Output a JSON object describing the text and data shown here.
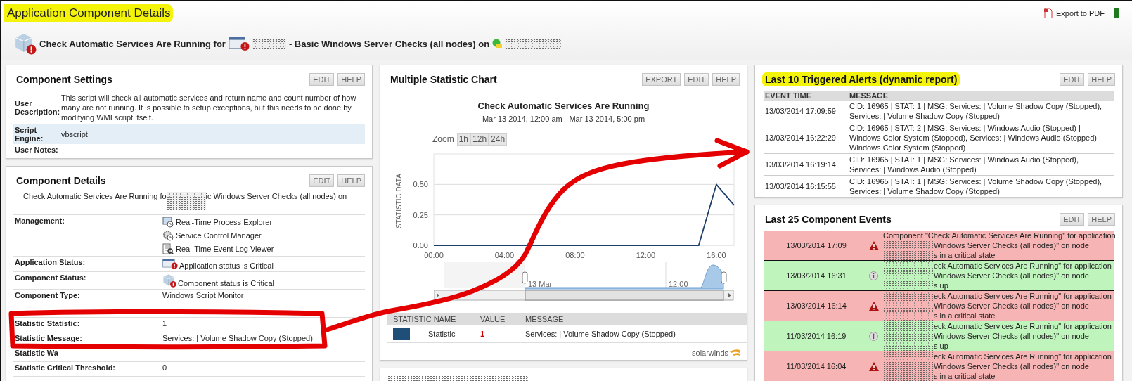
{
  "page": {
    "title": "Application Component Details",
    "export": "Export to PDF"
  },
  "heading": {
    "before": "Check Automatic Services Are Running for",
    "after": "- Basic Windows Server Checks (all nodes) on"
  },
  "component_settings": {
    "title": "Component Settings",
    "buttons": [
      "EDIT",
      "HELP"
    ],
    "rows": [
      {
        "label": "User Description:",
        "value": "This script will check all automatic services and return name and count number of how many are not running. It is possible to setup exceptions, but this needs to be done by modifying WMI script itself.",
        "shaded": false
      },
      {
        "label": "Script Engine:",
        "value": "vbscript",
        "shaded": true
      },
      {
        "label": "User Notes:",
        "shaded": false
      }
    ]
  },
  "component_details": {
    "title": "Component Details",
    "buttons": [
      "EDIT",
      "HELP"
    ],
    "summary": {
      "before": "Check Automatic Services Are Running fo",
      "after": "ic Windows Server Checks (all nodes) on"
    },
    "rows": [
      {
        "kind": "links",
        "label": "Management:",
        "items": [
          {
            "kind": "process",
            "text": "Real-Time Process Explorer"
          },
          {
            "kind": "service",
            "text": "Service Control Manager"
          },
          {
            "kind": "eventlog",
            "text": "Real-Time Event Log Viewer"
          }
        ]
      },
      {
        "kind": "app-status",
        "label": "Application Status:",
        "value": "Application status is Critical"
      },
      {
        "kind": "component-status",
        "label": "Component Status:",
        "value": "Component status is Critical"
      },
      {
        "kind": "text",
        "label": "Component Type:",
        "value": "Windows Script Monitor"
      },
      {
        "kind": "blank"
      },
      {
        "kind": "text",
        "label": "Statistic Statistic:",
        "value": "1"
      },
      {
        "kind": "text",
        "label": "Statistic Message:",
        "value": "Services: | Volume Shadow Copy (Stopped)"
      },
      {
        "kind": "text",
        "label": "Statistic Wa"
      },
      {
        "kind": "text",
        "label": "Statistic Critical Threshold:",
        "value": "0"
      }
    ]
  },
  "chart_panel": {
    "title": "Multiple Statistic Chart",
    "buttons": [
      "EXPORT",
      "EDIT",
      "HELP"
    ],
    "chart_title": "Check Automatic Services Are Running",
    "subtitle": "Mar 13 2014, 12:00 am - Mar 13 2014, 5:00 pm",
    "zoom": {
      "label": "Zoom",
      "options": [
        "1h",
        "12h",
        "24h"
      ]
    },
    "chart_data": {
      "type": "line",
      "ylabel": "STATISTIC DATA",
      "x": [
        0,
        1,
        2,
        3,
        4,
        5,
        6,
        7,
        8,
        9,
        10,
        11,
        12,
        13,
        14,
        15,
        16,
        17
      ],
      "series": [
        {
          "color": "#1f3f6b",
          "values": [
            0,
            0,
            0,
            0,
            0,
            0,
            0,
            0,
            0,
            0,
            0,
            0,
            0,
            0,
            0,
            0,
            0.5,
            0.33
          ]
        }
      ],
      "xlim": [
        0,
        17
      ],
      "ylim": [
        0,
        0.75
      ],
      "xticks": [
        {
          "value": 0,
          "label": "00:00"
        },
        {
          "value": 4,
          "label": "04:00"
        },
        {
          "value": 8,
          "label": "08:00"
        },
        {
          "value": 12,
          "label": "12:00"
        },
        {
          "value": 16,
          "label": "16:00"
        }
      ],
      "yticks": [
        {
          "value": 0,
          "label": "0.00"
        },
        {
          "value": 0.25,
          "label": "0.25"
        },
        {
          "value": 0.5,
          "label": "0.50"
        }
      ]
    },
    "navigator": {
      "labels": [
        "13 Mar",
        "12:00"
      ]
    },
    "table": {
      "columns": [
        "STATISTIC NAME",
        "VALUE",
        "MESSAGE"
      ],
      "rows": [
        {
          "color": "#1f4e79",
          "name": "Statistic",
          "value": "1",
          "message": "Services: | Volume Shadow Copy (Stopped)"
        }
      ]
    },
    "brand": "solarwinds"
  },
  "alerts": {
    "title": "Last 10 Triggered Alerts (dynamic report)",
    "buttons": [
      "EDIT",
      "HELP"
    ],
    "columns": [
      "EVENT TIME",
      "MESSAGE"
    ],
    "rows": [
      {
        "time": "13/03/2014 17:09:59",
        "message": "CID: 16965 | STAT: 1 | MSG: Services: | Volume Shadow Copy (Stopped), Services: | Volume Shadow Copy (Stopped)"
      },
      {
        "time": "13/03/2014 16:22:29",
        "message": "CID: 16965 | STAT: 2 | MSG: Services: | Windows Audio (Stopped) | Windows Color System (Stopped), Services: | Windows Audio (Stopped) | Windows Color System (Stopped)"
      },
      {
        "time": "13/03/2014 16:19:14",
        "message": "CID: 16965 | STAT: 1 | MSG: Services: | Windows Audio (Stopped), Services: | Windows Audio (Stopped)"
      },
      {
        "time": "13/03/2014 16:15:55",
        "message": "CID: 16965 | STAT: 1 | MSG: Services: | Volume Shadow Copy (Stopped), Services: | Volume Shadow Copy (Stopped)"
      }
    ]
  },
  "events": {
    "title": "Last 25 Component Events",
    "buttons": [
      "EDIT",
      "HELP"
    ],
    "rows": [
      {
        "time": "13/03/2014 17:09",
        "kind": "critical",
        "lines": [
          {
            "text": "Component \"Check Automatic Services Are Running\" for application",
            "redacted": false
          },
          {
            "text": "Windows Server Checks (all nodes)\" on node",
            "redacted": true
          },
          {
            "text": "s in a critical state",
            "redacted": true
          }
        ]
      },
      {
        "time": "13/03/2014 16:31",
        "kind": "up",
        "lines": [
          {
            "text": "eck Automatic Services Are Running\" for application",
            "redacted": true
          },
          {
            "text": "Windows Server Checks (all nodes)\" on node",
            "redacted": true
          },
          {
            "text": "s up",
            "redacted": true
          }
        ]
      },
      {
        "time": "13/03/2014 16:14",
        "kind": "critical",
        "lines": [
          {
            "text": "eck Automatic Services Are Running\" for application",
            "redacted": true
          },
          {
            "text": "Windows Server Checks (all nodes)\" on node",
            "redacted": true
          },
          {
            "text": "s in a critical state",
            "redacted": true
          }
        ]
      },
      {
        "time": "11/03/2014 16:19",
        "kind": "up",
        "lines": [
          {
            "text": "eck Automatic Services Are Running\" for application",
            "redacted": true
          },
          {
            "text": "Windows Server Checks (all nodes)\" on node",
            "redacted": true
          },
          {
            "text": "s up",
            "redacted": true
          }
        ]
      },
      {
        "time": "11/03/2014 16:04",
        "kind": "critical",
        "lines": [
          {
            "text": "eck Automatic Services Are Running\" for application",
            "redacted": true
          },
          {
            "text": "Windows Server Checks (all nodes)\" on node",
            "redacted": true
          },
          {
            "text": "s in a critical state",
            "redacted": true
          }
        ]
      }
    ]
  }
}
